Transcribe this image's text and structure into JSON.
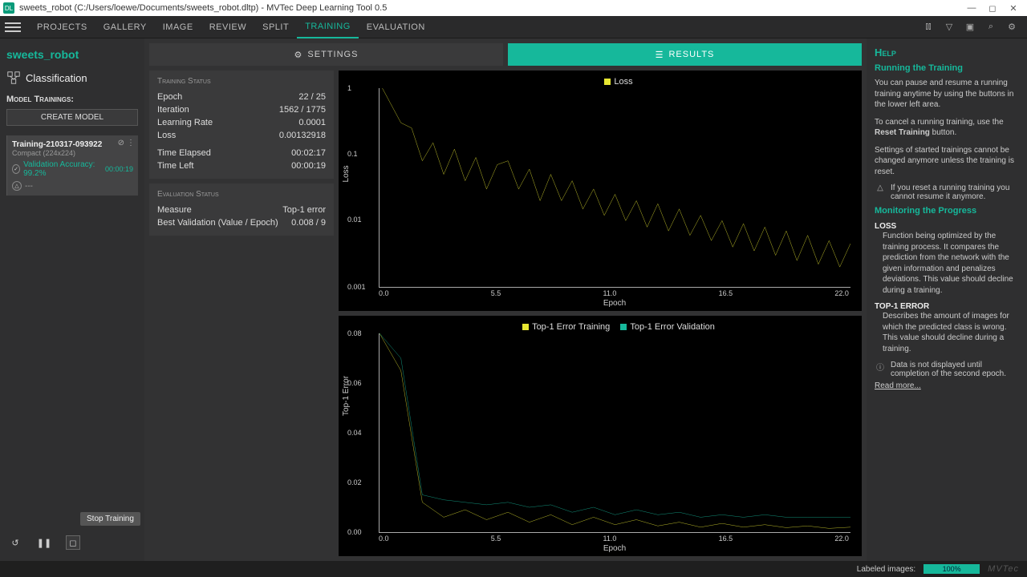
{
  "window": {
    "title": "sweets_robot (C:/Users/loewe/Documents/sweets_robot.dltp) - MVTec Deep Learning Tool 0.5"
  },
  "nav": {
    "items": [
      "PROJECTS",
      "GALLERY",
      "IMAGE",
      "REVIEW",
      "SPLIT",
      "TRAINING",
      "EVALUATION"
    ],
    "active_index": 5
  },
  "sidebar": {
    "project_name": "sweets_robot",
    "classification_label": "Classification",
    "model_trainings_label": "Model Trainings:",
    "create_model_label": "CREATE MODEL",
    "training": {
      "name": "Training-210317-093922",
      "subtitle": "Compact (224x224)",
      "validation_label": "Validation Accuracy: 99.2%",
      "validation_time": "00:00:19",
      "secondary": "---"
    },
    "stop_tooltip": "Stop Training"
  },
  "tabs": {
    "settings": "SETTINGS",
    "results": "RESULTS"
  },
  "training_status": {
    "heading": "Training Status",
    "epoch_label": "Epoch",
    "epoch_value": "22 / 25",
    "iteration_label": "Iteration",
    "iteration_value": "1562 / 1775",
    "lr_label": "Learning Rate",
    "lr_value": "0.0001",
    "loss_label": "Loss",
    "loss_value": "0.00132918",
    "elapsed_label": "Time Elapsed",
    "elapsed_value": "00:02:17",
    "left_label": "Time Left",
    "left_value": "00:00:19"
  },
  "evaluation_status": {
    "heading": "Evaluation Status",
    "measure_label": "Measure",
    "measure_value": "Top-1 error",
    "best_label": "Best Validation (Value / Epoch)",
    "best_value": "0.008 / 9"
  },
  "help": {
    "heading": "Help",
    "running_title": "Running the Training",
    "p1": "You can pause and resume a running training anytime by using the buttons in the lower left area.",
    "p2a": "To cancel a running training, use the ",
    "p2b": "Reset Training",
    "p2c": " button.",
    "p3": "Settings of started trainings cannot be changed anymore unless the training is reset.",
    "warn": "If you reset a running training you cannot resume it anymore.",
    "monitoring_title": "Monitoring the Progress",
    "loss_term": "LOSS",
    "loss_desc": "Function being optimized by the training process. It compares the prediction from the network with the given information and penalizes deviations. This value should decline during a training.",
    "top1_term": "TOP-1 ERROR",
    "top1_desc": "Describes the amount of images for which the predicted class is wrong. This value should decline during a training.",
    "info": "Data is not displayed until completion of the second epoch.",
    "read_more": "Read more..."
  },
  "statusbar": {
    "label": "Labeled images:",
    "pct": "100%",
    "brand": "MVTec"
  },
  "chart_data": [
    {
      "type": "line",
      "title": "Loss",
      "xlabel": "Epoch",
      "ylabel": "Loss",
      "xlim": [
        0,
        22
      ],
      "ylim_log": [
        0.001,
        1
      ],
      "yticks": [
        "1",
        "0.1",
        "0.01",
        "0.001"
      ],
      "xticks": [
        "0.0",
        "5.5",
        "11.0",
        "16.5",
        "22.0"
      ],
      "series": [
        {
          "name": "Loss",
          "color": "#e6e632",
          "x": [
            0,
            0.5,
            1,
            1.5,
            2,
            2.5,
            3,
            3.5,
            4,
            4.5,
            5,
            5.5,
            6,
            6.5,
            7,
            7.5,
            8,
            8.5,
            9,
            9.5,
            10,
            10.5,
            11,
            11.5,
            12,
            12.5,
            13,
            13.5,
            14,
            14.5,
            15,
            15.5,
            16,
            16.5,
            17,
            17.5,
            18,
            18.5,
            19,
            19.5,
            20,
            20.5,
            21,
            21.5,
            22
          ],
          "y": [
            1.2,
            0.6,
            0.3,
            0.25,
            0.08,
            0.15,
            0.05,
            0.12,
            0.04,
            0.09,
            0.03,
            0.07,
            0.08,
            0.03,
            0.06,
            0.02,
            0.05,
            0.02,
            0.04,
            0.015,
            0.03,
            0.012,
            0.025,
            0.01,
            0.02,
            0.008,
            0.018,
            0.007,
            0.015,
            0.006,
            0.012,
            0.005,
            0.01,
            0.004,
            0.009,
            0.0035,
            0.008,
            0.003,
            0.007,
            0.0025,
            0.006,
            0.0022,
            0.005,
            0.002,
            0.0045
          ]
        }
      ]
    },
    {
      "type": "line",
      "xlabel": "Epoch",
      "ylabel": "Top-1 Error",
      "xlim": [
        0,
        22
      ],
      "ylim": [
        0,
        0.08
      ],
      "yticks": [
        "0.08",
        "0.06",
        "0.04",
        "0.02",
        "0.00"
      ],
      "xticks": [
        "0.0",
        "5.5",
        "11.0",
        "16.5",
        "22.0"
      ],
      "series": [
        {
          "name": "Top-1 Error Training",
          "color": "#e6e632",
          "x": [
            0,
            1,
            2,
            3,
            4,
            5,
            6,
            7,
            8,
            9,
            10,
            11,
            12,
            13,
            14,
            15,
            16,
            17,
            18,
            19,
            20,
            21,
            22
          ],
          "y": [
            0.08,
            0.065,
            0.012,
            0.006,
            0.009,
            0.005,
            0.008,
            0.004,
            0.007,
            0.003,
            0.006,
            0.003,
            0.005,
            0.0025,
            0.004,
            0.002,
            0.0035,
            0.002,
            0.003,
            0.0018,
            0.0025,
            0.0015,
            0.002
          ]
        },
        {
          "name": "Top-1 Error Validation",
          "color": "#16b89b",
          "x": [
            0,
            1,
            2,
            3,
            4,
            5,
            6,
            7,
            8,
            9,
            10,
            11,
            12,
            13,
            14,
            15,
            16,
            17,
            18,
            19,
            20,
            21,
            22
          ],
          "y": [
            0.08,
            0.07,
            0.015,
            0.013,
            0.012,
            0.011,
            0.012,
            0.01,
            0.011,
            0.008,
            0.01,
            0.007,
            0.009,
            0.007,
            0.008,
            0.006,
            0.007,
            0.006,
            0.007,
            0.006,
            0.006,
            0.006,
            0.006
          ]
        }
      ]
    }
  ]
}
